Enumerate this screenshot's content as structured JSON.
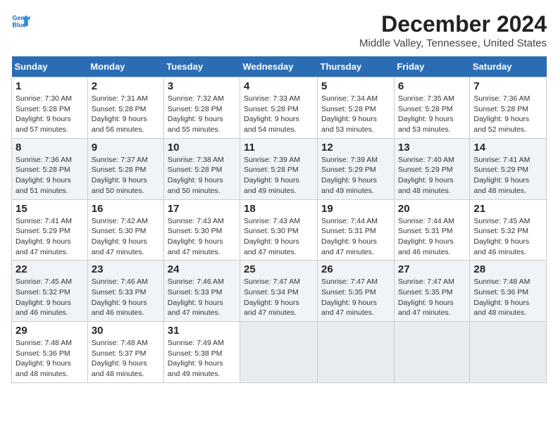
{
  "logo": {
    "line1": "General",
    "line2": "Blue"
  },
  "title": "December 2024",
  "location": "Middle Valley, Tennessee, United States",
  "days_of_week": [
    "Sunday",
    "Monday",
    "Tuesday",
    "Wednesday",
    "Thursday",
    "Friday",
    "Saturday"
  ],
  "weeks": [
    [
      {
        "day": "1",
        "sunrise": "7:30 AM",
        "sunset": "5:28 PM",
        "daylight": "9 hours and 57 minutes."
      },
      {
        "day": "2",
        "sunrise": "7:31 AM",
        "sunset": "5:28 PM",
        "daylight": "9 hours and 56 minutes."
      },
      {
        "day": "3",
        "sunrise": "7:32 AM",
        "sunset": "5:28 PM",
        "daylight": "9 hours and 55 minutes."
      },
      {
        "day": "4",
        "sunrise": "7:33 AM",
        "sunset": "5:28 PM",
        "daylight": "9 hours and 54 minutes."
      },
      {
        "day": "5",
        "sunrise": "7:34 AM",
        "sunset": "5:28 PM",
        "daylight": "9 hours and 53 minutes."
      },
      {
        "day": "6",
        "sunrise": "7:35 AM",
        "sunset": "5:28 PM",
        "daylight": "9 hours and 53 minutes."
      },
      {
        "day": "7",
        "sunrise": "7:36 AM",
        "sunset": "5:28 PM",
        "daylight": "9 hours and 52 minutes."
      }
    ],
    [
      {
        "day": "8",
        "sunrise": "7:36 AM",
        "sunset": "5:28 PM",
        "daylight": "9 hours and 51 minutes."
      },
      {
        "day": "9",
        "sunrise": "7:37 AM",
        "sunset": "5:28 PM",
        "daylight": "9 hours and 50 minutes."
      },
      {
        "day": "10",
        "sunrise": "7:38 AM",
        "sunset": "5:28 PM",
        "daylight": "9 hours and 50 minutes."
      },
      {
        "day": "11",
        "sunrise": "7:39 AM",
        "sunset": "5:28 PM",
        "daylight": "9 hours and 49 minutes."
      },
      {
        "day": "12",
        "sunrise": "7:39 AM",
        "sunset": "5:29 PM",
        "daylight": "9 hours and 49 minutes."
      },
      {
        "day": "13",
        "sunrise": "7:40 AM",
        "sunset": "5:29 PM",
        "daylight": "9 hours and 48 minutes."
      },
      {
        "day": "14",
        "sunrise": "7:41 AM",
        "sunset": "5:29 PM",
        "daylight": "9 hours and 48 minutes."
      }
    ],
    [
      {
        "day": "15",
        "sunrise": "7:41 AM",
        "sunset": "5:29 PM",
        "daylight": "9 hours and 47 minutes."
      },
      {
        "day": "16",
        "sunrise": "7:42 AM",
        "sunset": "5:30 PM",
        "daylight": "9 hours and 47 minutes."
      },
      {
        "day": "17",
        "sunrise": "7:43 AM",
        "sunset": "5:30 PM",
        "daylight": "9 hours and 47 minutes."
      },
      {
        "day": "18",
        "sunrise": "7:43 AM",
        "sunset": "5:30 PM",
        "daylight": "9 hours and 47 minutes."
      },
      {
        "day": "19",
        "sunrise": "7:44 AM",
        "sunset": "5:31 PM",
        "daylight": "9 hours and 47 minutes."
      },
      {
        "day": "20",
        "sunrise": "7:44 AM",
        "sunset": "5:31 PM",
        "daylight": "9 hours and 46 minutes."
      },
      {
        "day": "21",
        "sunrise": "7:45 AM",
        "sunset": "5:32 PM",
        "daylight": "9 hours and 46 minutes."
      }
    ],
    [
      {
        "day": "22",
        "sunrise": "7:45 AM",
        "sunset": "5:32 PM",
        "daylight": "9 hours and 46 minutes."
      },
      {
        "day": "23",
        "sunrise": "7:46 AM",
        "sunset": "5:33 PM",
        "daylight": "9 hours and 46 minutes."
      },
      {
        "day": "24",
        "sunrise": "7:46 AM",
        "sunset": "5:33 PM",
        "daylight": "9 hours and 47 minutes."
      },
      {
        "day": "25",
        "sunrise": "7:47 AM",
        "sunset": "5:34 PM",
        "daylight": "9 hours and 47 minutes."
      },
      {
        "day": "26",
        "sunrise": "7:47 AM",
        "sunset": "5:35 PM",
        "daylight": "9 hours and 47 minutes."
      },
      {
        "day": "27",
        "sunrise": "7:47 AM",
        "sunset": "5:35 PM",
        "daylight": "9 hours and 47 minutes."
      },
      {
        "day": "28",
        "sunrise": "7:48 AM",
        "sunset": "5:36 PM",
        "daylight": "9 hours and 48 minutes."
      }
    ],
    [
      {
        "day": "29",
        "sunrise": "7:48 AM",
        "sunset": "5:36 PM",
        "daylight": "9 hours and 48 minutes."
      },
      {
        "day": "30",
        "sunrise": "7:48 AM",
        "sunset": "5:37 PM",
        "daylight": "9 hours and 48 minutes."
      },
      {
        "day": "31",
        "sunrise": "7:49 AM",
        "sunset": "5:38 PM",
        "daylight": "9 hours and 49 minutes."
      },
      null,
      null,
      null,
      null
    ]
  ],
  "labels": {
    "sunrise": "Sunrise:",
    "sunset": "Sunset:",
    "daylight": "Daylight:"
  }
}
